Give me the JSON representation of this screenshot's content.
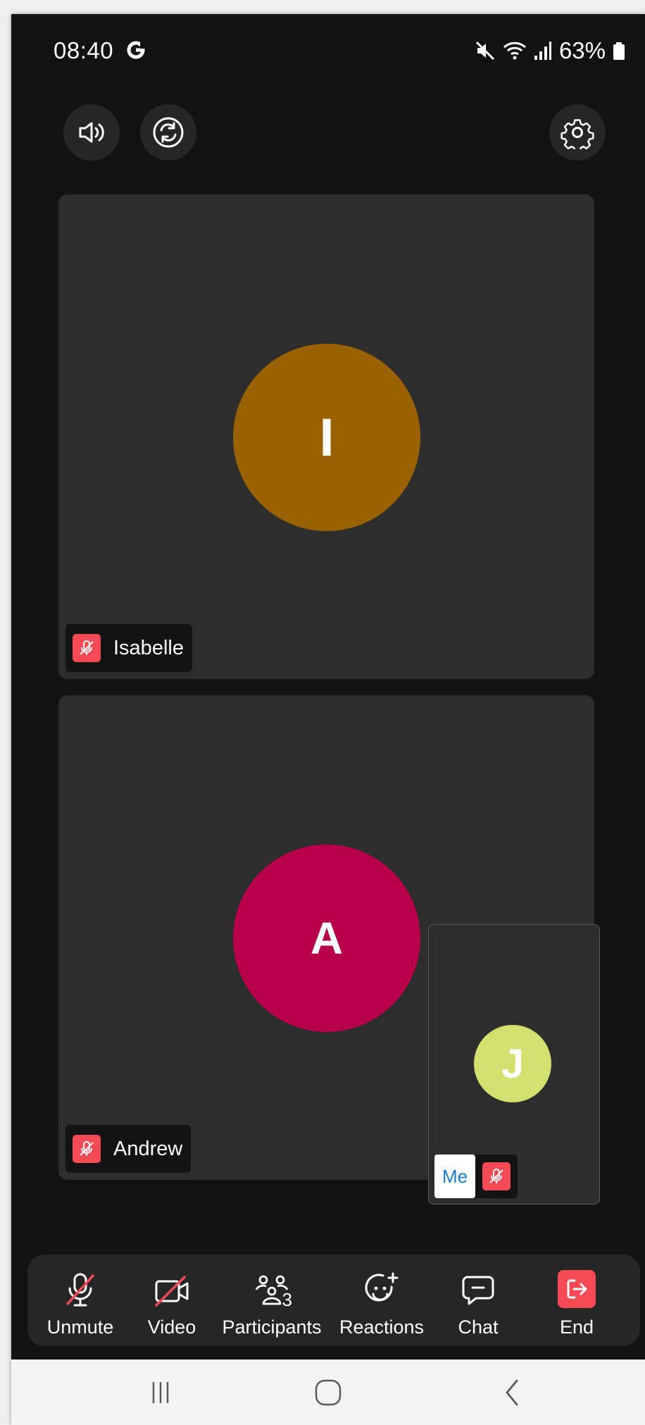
{
  "status_bar": {
    "time": "08:40",
    "battery": "63%",
    "icons": [
      "google-icon",
      "mute-icon",
      "wifi-icon",
      "signal-icon",
      "battery-icon"
    ]
  },
  "top_controls": {
    "speaker_icon": "speaker-icon",
    "switch_camera_icon": "switch-camera-icon",
    "settings_icon": "gear-icon"
  },
  "participants": [
    {
      "name": "Isabelle",
      "initial": "I",
      "color": "#9a6100",
      "muted": true
    },
    {
      "name": "Andrew",
      "initial": "A",
      "color": "#b8004a",
      "muted": true
    }
  ],
  "self_view": {
    "initial": "J",
    "color": "#d1e06e",
    "label": "Me",
    "muted": true
  },
  "toolbar": {
    "unmute": "Unmute",
    "video": "Video",
    "participants": "Participants",
    "participants_count": "3",
    "reactions": "Reactions",
    "chat": "Chat",
    "end": "End",
    "end_color": "#f44a55"
  },
  "navbar": {
    "icons": [
      "recent-apps-icon",
      "home-icon",
      "back-icon"
    ]
  }
}
